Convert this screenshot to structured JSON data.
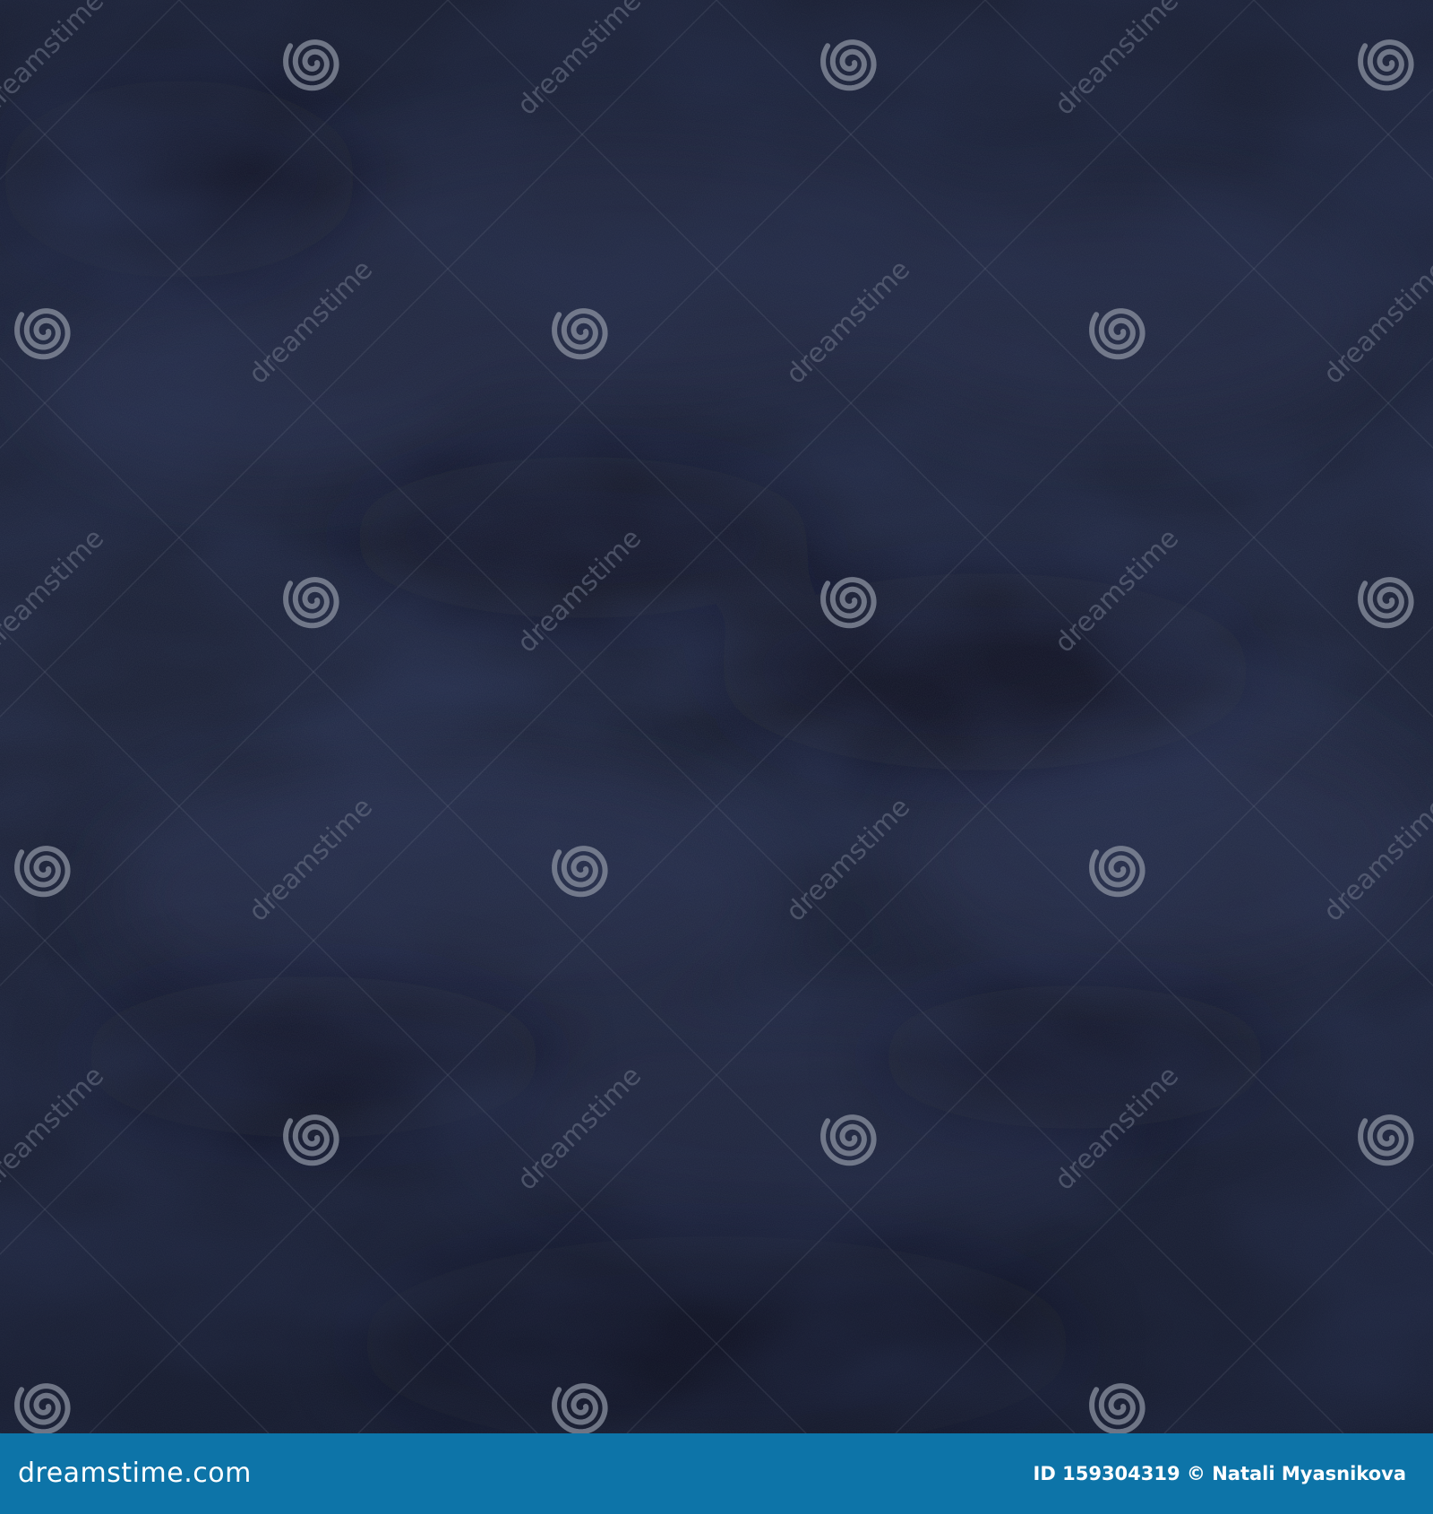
{
  "image": {
    "subject": "dark navy watercolor paper texture",
    "colors": {
      "base": "#1b2136",
      "dark": "#0e1222",
      "light": "#262d47",
      "watermark": "#8b91a0",
      "footer": "#0d74a8"
    }
  },
  "watermark": {
    "text": "dreamstime",
    "icon": "dreamstime-spiral-logo-icon"
  },
  "footer": {
    "site": "dreamstime.com",
    "credit": "ID 159304319 © Natali Myasnikova"
  }
}
